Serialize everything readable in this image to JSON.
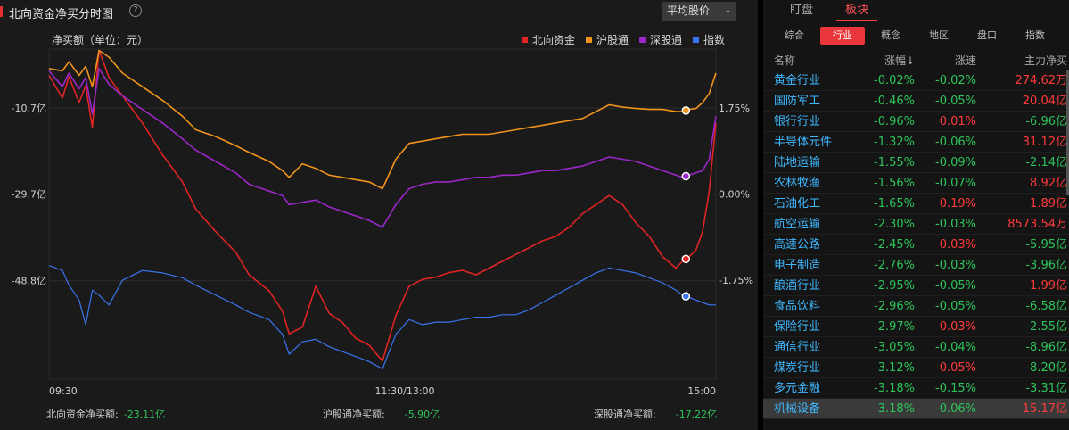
{
  "left_panel": {
    "title": "北向资金净买分时图",
    "help_icon": "?",
    "dropdown": {
      "selected": "平均股价",
      "caret": "⌄"
    },
    "unit_label": "净买额（单位：元）",
    "legend": [
      {
        "label": "北向资金",
        "color": "#e02424"
      },
      {
        "label": "沪股通",
        "color": "#f0931c"
      },
      {
        "label": "深股通",
        "color": "#9b27c7"
      },
      {
        "label": "指数",
        "color": "#3a74ee"
      }
    ],
    "bottom_stats": [
      {
        "label": "北向资金净买额:",
        "value": "-23.11亿"
      },
      {
        "label": "沪股通净买额:",
        "value": "-5.90亿"
      },
      {
        "label": "深股通净买额:",
        "value": "-17.22亿"
      }
    ]
  },
  "chart_data": {
    "type": "line",
    "x_ticks": [
      "09:30",
      "11:30/13:00",
      "15:00"
    ],
    "y_left_ticks": [
      "-10.7亿",
      "-29.7亿",
      "-48.8亿"
    ],
    "y_left_values": [
      -10.7,
      -29.7,
      -48.8
    ],
    "y_right_ticks": [
      "1.75%",
      "0.00%",
      "-1.75%"
    ],
    "y_right_values": [
      1.75,
      0.0,
      -1.75
    ],
    "ylim_left": [
      -70.5,
      2.3
    ],
    "series": [
      {
        "name": "北向资金",
        "color": "#e02424",
        "axis": "left",
        "x": [
          0,
          0.02,
          0.03,
          0.045,
          0.055,
          0.065,
          0.075,
          0.09,
          0.11,
          0.14,
          0.17,
          0.2,
          0.22,
          0.25,
          0.28,
          0.3,
          0.33,
          0.35,
          0.36,
          0.38,
          0.4,
          0.42,
          0.44,
          0.46,
          0.48,
          0.5,
          0.52,
          0.54,
          0.56,
          0.58,
          0.6,
          0.62,
          0.64,
          0.66,
          0.68,
          0.7,
          0.72,
          0.74,
          0.76,
          0.78,
          0.8,
          0.82,
          0.84,
          0.86,
          0.88,
          0.9,
          0.92,
          0.94,
          0.95,
          0.96,
          0.97,
          0.98,
          0.99,
          1.0
        ],
        "y": [
          -3.5,
          -8.5,
          -3.8,
          -9.5,
          -5.8,
          -15.0,
          2.0,
          -4.0,
          -8.0,
          -14.0,
          -21.0,
          -27.0,
          -33.0,
          -38.0,
          -42.5,
          -47.5,
          -51.0,
          -55.5,
          -60.5,
          -59.0,
          -50.0,
          -56.0,
          -58.0,
          -61.5,
          -63.0,
          -66.5,
          -56.5,
          -50.0,
          -48.5,
          -48.0,
          -47.0,
          -46.5,
          -47.5,
          -46.0,
          -44.5,
          -43.0,
          -41.5,
          -40.0,
          -39.0,
          -37.0,
          -34.0,
          -32.0,
          -30.0,
          -32.0,
          -36.0,
          -39.0,
          -43.5,
          -46.0,
          -44.5,
          -43.5,
          -42.0,
          -38.0,
          -29.0,
          -14.0
        ]
      },
      {
        "name": "沪股通",
        "color": "#f0931c",
        "axis": "left",
        "x": [
          0,
          0.02,
          0.03,
          0.045,
          0.055,
          0.065,
          0.075,
          0.09,
          0.11,
          0.14,
          0.17,
          0.2,
          0.22,
          0.25,
          0.28,
          0.3,
          0.33,
          0.35,
          0.36,
          0.38,
          0.4,
          0.42,
          0.44,
          0.46,
          0.48,
          0.5,
          0.52,
          0.54,
          0.56,
          0.58,
          0.6,
          0.62,
          0.64,
          0.66,
          0.68,
          0.7,
          0.72,
          0.74,
          0.76,
          0.78,
          0.8,
          0.82,
          0.84,
          0.86,
          0.88,
          0.9,
          0.92,
          0.94,
          0.95,
          0.96,
          0.97,
          0.98,
          0.99,
          1.0
        ],
        "y": [
          -2.0,
          -2.5,
          -0.5,
          -3.5,
          -1.5,
          -6.0,
          2.0,
          0.5,
          -3.0,
          -6.0,
          -9.0,
          -12.5,
          -15.5,
          -17.0,
          -19.0,
          -20.5,
          -22.5,
          -24.5,
          -26.0,
          -23.0,
          -24.0,
          -25.5,
          -26.0,
          -26.5,
          -27.0,
          -28.5,
          -22.0,
          -18.5,
          -18.0,
          -17.5,
          -17.0,
          -16.5,
          -16.5,
          -16.5,
          -16.0,
          -15.5,
          -15.0,
          -14.5,
          -14.0,
          -13.5,
          -13.0,
          -11.5,
          -10.0,
          -10.5,
          -10.8,
          -11.0,
          -11.0,
          -11.5,
          -11.5,
          -11.0,
          -10.8,
          -9.5,
          -7.5,
          -3.0
        ]
      },
      {
        "name": "深股通",
        "color": "#9b27c7",
        "axis": "left",
        "x": [
          0,
          0.02,
          0.03,
          0.045,
          0.055,
          0.065,
          0.075,
          0.09,
          0.11,
          0.14,
          0.17,
          0.2,
          0.22,
          0.25,
          0.28,
          0.3,
          0.33,
          0.35,
          0.36,
          0.38,
          0.4,
          0.42,
          0.44,
          0.46,
          0.48,
          0.5,
          0.52,
          0.54,
          0.56,
          0.58,
          0.6,
          0.62,
          0.64,
          0.66,
          0.68,
          0.7,
          0.72,
          0.74,
          0.76,
          0.78,
          0.8,
          0.82,
          0.84,
          0.86,
          0.88,
          0.9,
          0.92,
          0.94,
          0.95,
          0.96,
          0.97,
          0.98,
          0.99,
          1.0
        ],
        "y": [
          -2.5,
          -6.0,
          -3.0,
          -6.5,
          -4.0,
          -12.0,
          -2.0,
          -5.5,
          -8.0,
          -11.0,
          -14.0,
          -17.5,
          -20.0,
          -22.5,
          -25.0,
          -27.5,
          -29.0,
          -30.0,
          -32.0,
          -31.5,
          -31.0,
          -32.5,
          -33.5,
          -34.5,
          -35.5,
          -37.0,
          -32.0,
          -28.5,
          -27.5,
          -27.0,
          -27.0,
          -26.5,
          -26.0,
          -26.0,
          -25.5,
          -25.5,
          -25.0,
          -24.5,
          -24.5,
          -24.0,
          -23.5,
          -22.5,
          -21.5,
          -22.0,
          -22.5,
          -23.5,
          -24.5,
          -25.5,
          -26.0,
          -25.5,
          -25.0,
          -24.5,
          -22.0,
          -12.5
        ]
      },
      {
        "name": "指数",
        "color": "#3a74ee",
        "axis": "right",
        "x": [
          0,
          0.02,
          0.03,
          0.045,
          0.055,
          0.065,
          0.075,
          0.09,
          0.11,
          0.14,
          0.17,
          0.2,
          0.22,
          0.25,
          0.28,
          0.3,
          0.33,
          0.35,
          0.36,
          0.38,
          0.4,
          0.42,
          0.44,
          0.46,
          0.48,
          0.5,
          0.52,
          0.54,
          0.56,
          0.58,
          0.6,
          0.62,
          0.64,
          0.66,
          0.68,
          0.7,
          0.72,
          0.74,
          0.76,
          0.78,
          0.8,
          0.82,
          0.84,
          0.86,
          0.88,
          0.9,
          0.92,
          0.94,
          0.95,
          0.96,
          0.97,
          0.98,
          0.99,
          1.0
        ],
        "y": [
          -1.45,
          -1.55,
          -1.85,
          -2.15,
          -2.65,
          -1.95,
          -2.05,
          -2.25,
          -1.75,
          -1.55,
          -1.6,
          -1.7,
          -1.85,
          -2.05,
          -2.25,
          -2.4,
          -2.55,
          -2.85,
          -3.25,
          -3.0,
          -2.95,
          -3.1,
          -3.2,
          -3.3,
          -3.4,
          -3.55,
          -2.85,
          -2.55,
          -2.65,
          -2.6,
          -2.6,
          -2.55,
          -2.5,
          -2.5,
          -2.45,
          -2.45,
          -2.35,
          -2.2,
          -2.05,
          -1.9,
          -1.75,
          -1.6,
          -1.5,
          -1.55,
          -1.6,
          -1.7,
          -1.8,
          -1.95,
          -2.05,
          -2.1,
          -2.15,
          -2.2,
          -2.25,
          -2.25
        ]
      }
    ]
  },
  "right_panel": {
    "top_tabs": [
      "盯盘",
      "板块"
    ],
    "active_top_tab": 1,
    "sub_tabs": [
      "综合",
      "行业",
      "概念",
      "地区",
      "盘口",
      "指数"
    ],
    "active_sub_tab": 1,
    "headers": {
      "name": "名称",
      "change": "涨幅↓",
      "speed": "涨速",
      "flow": "主力净买"
    },
    "rows": [
      {
        "name": "黄金行业",
        "change": "-0.02%",
        "speed": "-0.02%",
        "flow": "274.62万",
        "speed_up": false,
        "flow_up": true
      },
      {
        "name": "国防军工",
        "change": "-0.46%",
        "speed": "-0.05%",
        "flow": "20.04亿",
        "speed_up": false,
        "flow_up": true
      },
      {
        "name": "银行行业",
        "change": "-0.96%",
        "speed": "0.01%",
        "flow": "-6.96亿",
        "speed_up": true,
        "flow_up": false
      },
      {
        "name": "半导体元件",
        "change": "-1.32%",
        "speed": "-0.06%",
        "flow": "31.12亿",
        "speed_up": false,
        "flow_up": true
      },
      {
        "name": "陆地运输",
        "change": "-1.55%",
        "speed": "-0.09%",
        "flow": "-2.14亿",
        "speed_up": false,
        "flow_up": false
      },
      {
        "name": "农林牧渔",
        "change": "-1.56%",
        "speed": "-0.07%",
        "flow": "8.92亿",
        "speed_up": false,
        "flow_up": true
      },
      {
        "name": "石油化工",
        "change": "-1.65%",
        "speed": "0.19%",
        "flow": "1.89亿",
        "speed_up": true,
        "flow_up": true
      },
      {
        "name": "航空运输",
        "change": "-2.30%",
        "speed": "-0.03%",
        "flow": "8573.54万",
        "speed_up": false,
        "flow_up": true
      },
      {
        "name": "高速公路",
        "change": "-2.45%",
        "speed": "0.03%",
        "flow": "-5.95亿",
        "speed_up": true,
        "flow_up": false
      },
      {
        "name": "电子制造",
        "change": "-2.76%",
        "speed": "-0.03%",
        "flow": "-3.96亿",
        "speed_up": false,
        "flow_up": false
      },
      {
        "name": "酿酒行业",
        "change": "-2.95%",
        "speed": "-0.05%",
        "flow": "1.99亿",
        "speed_up": false,
        "flow_up": true
      },
      {
        "name": "食品饮料",
        "change": "-2.96%",
        "speed": "-0.05%",
        "flow": "-6.58亿",
        "speed_up": false,
        "flow_up": false
      },
      {
        "name": "保险行业",
        "change": "-2.97%",
        "speed": "0.03%",
        "flow": "-2.55亿",
        "speed_up": true,
        "flow_up": false
      },
      {
        "name": "通信行业",
        "change": "-3.05%",
        "speed": "-0.04%",
        "flow": "-8.96亿",
        "speed_up": false,
        "flow_up": false
      },
      {
        "name": "煤炭行业",
        "change": "-3.12%",
        "speed": "0.05%",
        "flow": "-8.20亿",
        "speed_up": true,
        "flow_up": false
      },
      {
        "name": "多元金融",
        "change": "-3.18%",
        "speed": "-0.15%",
        "flow": "-3.31亿",
        "speed_up": false,
        "flow_up": false
      },
      {
        "name": "机械设备",
        "change": "-3.18%",
        "speed": "-0.06%",
        "flow": "15.17亿",
        "speed_up": false,
        "flow_up": true
      }
    ],
    "selected_row": 16
  }
}
